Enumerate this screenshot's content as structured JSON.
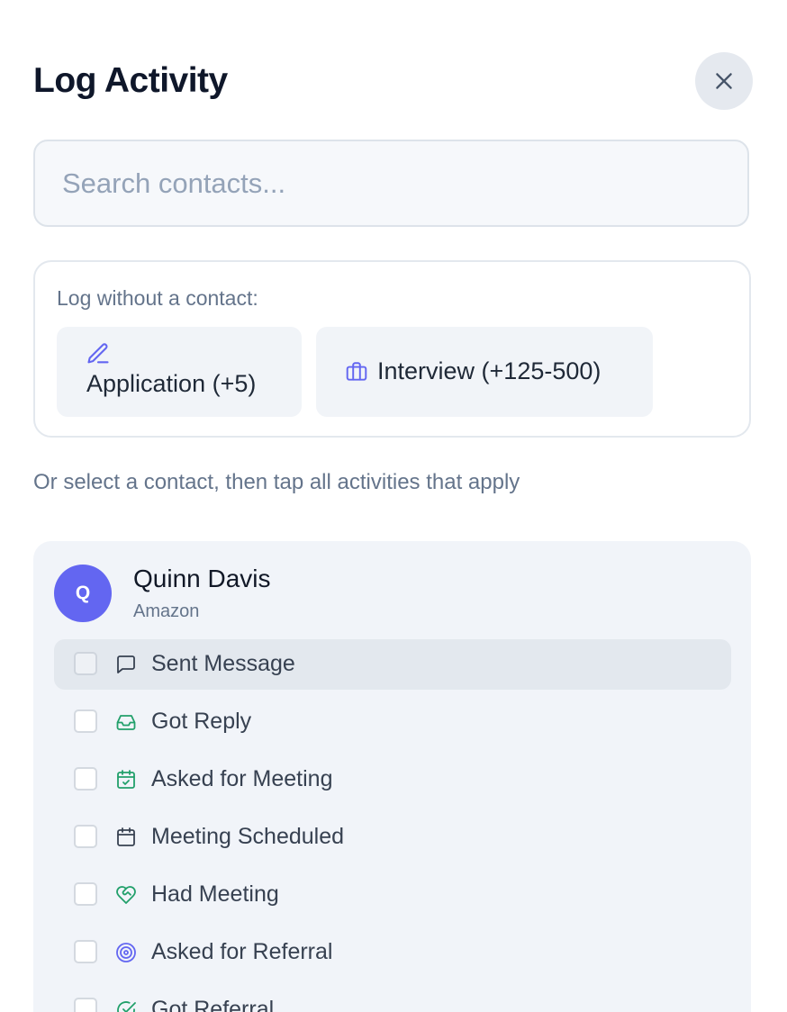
{
  "modal": {
    "title": "Log Activity",
    "close_icon": "x-icon"
  },
  "search": {
    "placeholder": "Search contacts..."
  },
  "no_contact": {
    "label": "Log without a contact:",
    "chips": [
      {
        "label": "Application (+5)",
        "icon": "pencil-icon",
        "color": "#6366f1"
      },
      {
        "label": "Interview (+125-500)",
        "icon": "briefcase-icon",
        "color": "#6366f1"
      }
    ]
  },
  "hint": "Or select a contact, then tap all activities that apply",
  "contact": {
    "initial": "Q",
    "name": "Quinn Davis",
    "company": "Amazon",
    "avatar_color": "#6366f1",
    "activities": [
      {
        "label": "Sent Message",
        "icon": "message-square-icon",
        "color": "#374151",
        "checked": false,
        "highlighted": true
      },
      {
        "label": "Got Reply",
        "icon": "inbox-icon",
        "color": "#22a06b",
        "checked": false
      },
      {
        "label": "Asked for Meeting",
        "icon": "calendar-check-icon",
        "color": "#22a06b",
        "checked": false
      },
      {
        "label": "Meeting Scheduled",
        "icon": "calendar-icon",
        "color": "#374151",
        "checked": false
      },
      {
        "label": "Had Meeting",
        "icon": "heart-handshake-icon",
        "color": "#22a06b",
        "checked": false
      },
      {
        "label": "Asked for Referral",
        "icon": "target-icon",
        "color": "#6366f1",
        "checked": false
      },
      {
        "label": "Got Referral",
        "icon": "check-circle-icon",
        "color": "#22a06b",
        "checked": false
      }
    ]
  }
}
